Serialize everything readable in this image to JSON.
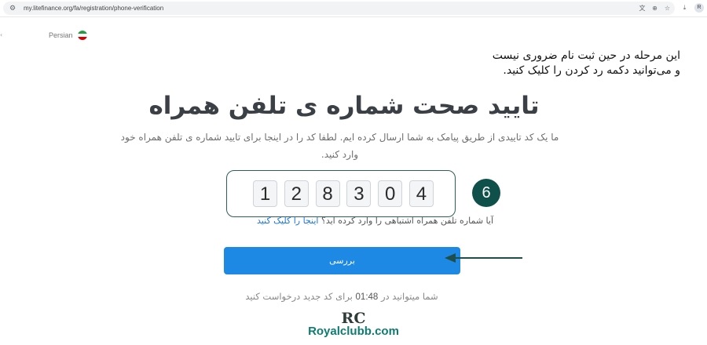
{
  "browser": {
    "url": "my.litefinance.org/fa/registration/phone-verification",
    "avatar_letter": "R",
    "icons": [
      "site-info-icon",
      "translate-icon",
      "zoom-icon",
      "bookmark-star-icon",
      "download-icon"
    ]
  },
  "language": {
    "label": "Persian",
    "flag": "iran-flag-icon",
    "flag_colors": [
      "#239f40",
      "#ffffff",
      "#da0000"
    ]
  },
  "annotation": {
    "line1": "این مرحله در حین ثبت نام ضروری نیست",
    "line2": "و می‌توانید دکمه رد کردن را کلیک کنید.",
    "step_number": "6"
  },
  "main": {
    "title": "تایید صحت شماره ی تلفن همراه",
    "description": "ما یک کد تاییدی از طریق پیامک به شما ارسال کرده ایم. لطفا کد را در اینجا برای تایید شماره ی تلفن همراه خود وارد کنید.",
    "code_digits": [
      "1",
      "2",
      "8",
      "3",
      "0",
      "4"
    ],
    "wrong_number_text": "آیا شماره تلفن همراه اشتباهی را وارد کرده اید؟",
    "wrong_number_link": "اینجا را کلیک کنید",
    "submit_label": "بررسی",
    "timer_prefix": "شما میتوانید در",
    "timer_value": "01:48",
    "timer_suffix": "برای کد جدید درخواست کنید"
  },
  "watermark": {
    "mark": "RC",
    "text": "Royalclubb.com",
    "color": "#0e7c72"
  },
  "colors": {
    "primary_button": "#1e88e5",
    "link": "#1a73e8",
    "step_badge": "#10504a"
  }
}
